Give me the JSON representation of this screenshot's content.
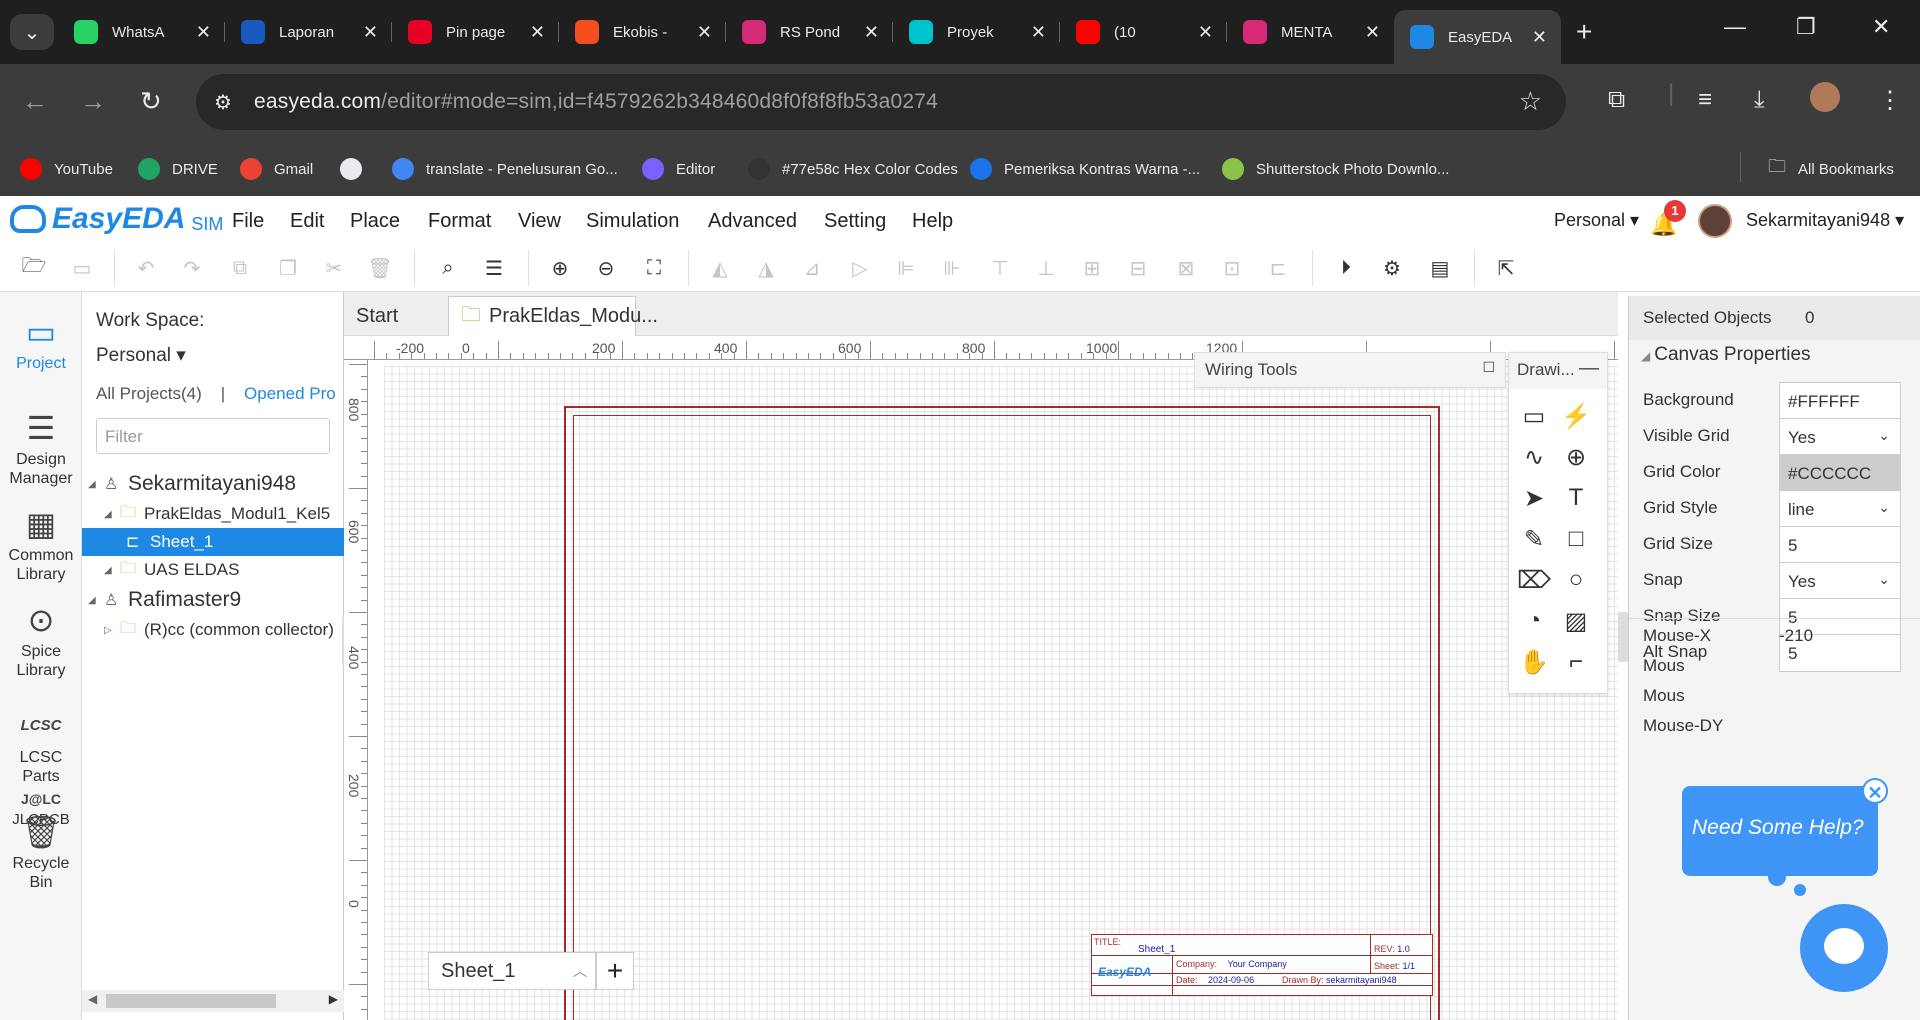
{
  "browser": {
    "tabs": [
      {
        "title": "WhatsA",
        "icon": "whatsapp-icon",
        "color": "#25d366"
      },
      {
        "title": "Laporan",
        "icon": "word-icon",
        "color": "#185abd"
      },
      {
        "title": "Pin page",
        "icon": "pinterest-icon",
        "color": "#e60023"
      },
      {
        "title": "Ekobis -",
        "icon": "figma-icon",
        "color": "#f24e1e"
      },
      {
        "title": "RS Pond",
        "icon": "instagram-icon",
        "color": "#d62976"
      },
      {
        "title": "Proyek",
        "icon": "canva-icon",
        "color": "#00c4cc"
      },
      {
        "title": "(10",
        "icon": "youtube-icon",
        "color": "#ff0000"
      },
      {
        "title": "MENTA",
        "icon": "instagram-icon",
        "color": "#d62976"
      },
      {
        "title": "EasyEDA",
        "icon": "easyeda-icon",
        "color": "#1e88e5"
      }
    ],
    "url_host": "easyeda.com",
    "url_path": "/editor#mode=sim,id=f4579262b348460d8f0f8f8fb53a0274",
    "bookmarks": [
      {
        "label": "YouTube",
        "color": "#ff0000"
      },
      {
        "label": "DRIVE",
        "color": "#1fa463"
      },
      {
        "label": "Gmail",
        "color": "#ea4335"
      },
      {
        "label": "",
        "color": "#e8eaed"
      },
      {
        "label": "translate - Penelusuran Go...",
        "color": "#4285f4"
      },
      {
        "label": "Editor",
        "color": "#7b61ff"
      },
      {
        "label": "#77e58c Hex Color Codes",
        "color": "#333333"
      },
      {
        "label": "Pemeriksa Kontras Warna -...",
        "color": "#1a73e8"
      },
      {
        "label": "Shutterstock Photo Downlo...",
        "color": "#8bc34a"
      }
    ],
    "all_bookmarks": "All Bookmarks"
  },
  "app": {
    "logo": "EasyEDA",
    "logo_sub": "SIM",
    "menu": [
      "File",
      "Edit",
      "Place",
      "Format",
      "View",
      "Simulation",
      "Advanced",
      "Setting",
      "Help"
    ],
    "account_mode": "Personal",
    "notification_count": "1",
    "username": "Sekarmitayani948"
  },
  "leftnav": [
    {
      "label": "Project",
      "icon": "folder-icon"
    },
    {
      "label": "Design Manager",
      "icon": "list-icon"
    },
    {
      "label": "Common Library",
      "icon": "chip-icon"
    },
    {
      "label": "Spice Library",
      "icon": "search-chip-icon"
    },
    {
      "label": "LCSC Parts",
      "icon": "lcsc-icon"
    },
    {
      "label": "JLCPCB",
      "icon": "jlc-icon"
    },
    {
      "label": "Recycle Bin",
      "icon": "trash-icon"
    }
  ],
  "project_panel": {
    "workspace_label": "Work Space:",
    "workspace_value": "Personal",
    "all_projects": "All Projects(4)",
    "separator": "|",
    "opened_projects": "Opened Pro",
    "filter_placeholder": "Filter",
    "tree": [
      {
        "label": "Sekarmitayani948"
      },
      {
        "label": "PrakEldas_Modul1_Kel5"
      },
      {
        "label": "Sheet_1"
      },
      {
        "label": "UAS ELDAS"
      },
      {
        "label": "Rafimaster9"
      },
      {
        "label": "(R)cc (common collector)"
      }
    ]
  },
  "doc_tabs": [
    "Start",
    "PrakEldas_Modu..."
  ],
  "rulers": {
    "top": [
      "-200",
      "0",
      "200",
      "400",
      "600",
      "800",
      "1000",
      "1200"
    ],
    "left": [
      "800",
      "600",
      "400",
      "200",
      "0"
    ]
  },
  "title_block": {
    "title_label": "TITLE:",
    "title": "Sheet_1",
    "rev_label": "REV:",
    "rev": "1.0",
    "company_label": "Company:",
    "company": "Your Company",
    "sheet_label": "Sheet:",
    "sheet": "1/1",
    "date_label": "Date:",
    "date": "2024-09-06",
    "drawn_label": "Drawn By:",
    "drawn_by": "sekarmitayani948",
    "brand": "EasyEDA"
  },
  "wiring_tools": {
    "title": "Wiring Tools"
  },
  "drawing_tools": {
    "title": "Drawi...",
    "icons": [
      "sheet-icon",
      "bus-icon",
      "bezier-icon",
      "arc-plus-icon",
      "arrow-icon",
      "text-icon",
      "pencil-icon",
      "rectangle-icon",
      "flag-icon",
      "circle-icon",
      "pie-icon",
      "image-icon",
      "hand-icon",
      "line-icon"
    ]
  },
  "sheet_selector": {
    "value": "Sheet_1",
    "add": "+"
  },
  "canvas_props": {
    "selected_label": "Selected Objects",
    "selected_count": "0",
    "section": "Canvas Properties",
    "rows": [
      {
        "label": "Background",
        "value": "#FFFFFF",
        "kind": "text"
      },
      {
        "label": "Visible Grid",
        "value": "Yes",
        "kind": "select"
      },
      {
        "label": "Grid Color",
        "value": "#CCCCCC",
        "kind": "text"
      },
      {
        "label": "Grid Style",
        "value": "line",
        "kind": "select"
      },
      {
        "label": "Grid Size",
        "value": "5",
        "kind": "text"
      },
      {
        "label": "Snap",
        "value": "Yes",
        "kind": "select"
      },
      {
        "label": "Snap Size",
        "value": "5",
        "kind": "text"
      },
      {
        "label": "Alt Snap",
        "value": "5",
        "kind": "text"
      }
    ],
    "mouse_x_label": "Mouse-X",
    "mouse_x_value": "-210",
    "mouse_y_label": "Mous",
    "mouse_dx_label": "Mous",
    "mouse_dy_label": "Mouse-DY"
  },
  "help": {
    "text": "Need Some Help?",
    "close": "✕"
  },
  "colors": {
    "accent": "#1e88e5",
    "sheet_border": "#a52a2a",
    "help": "#3f95f5"
  }
}
